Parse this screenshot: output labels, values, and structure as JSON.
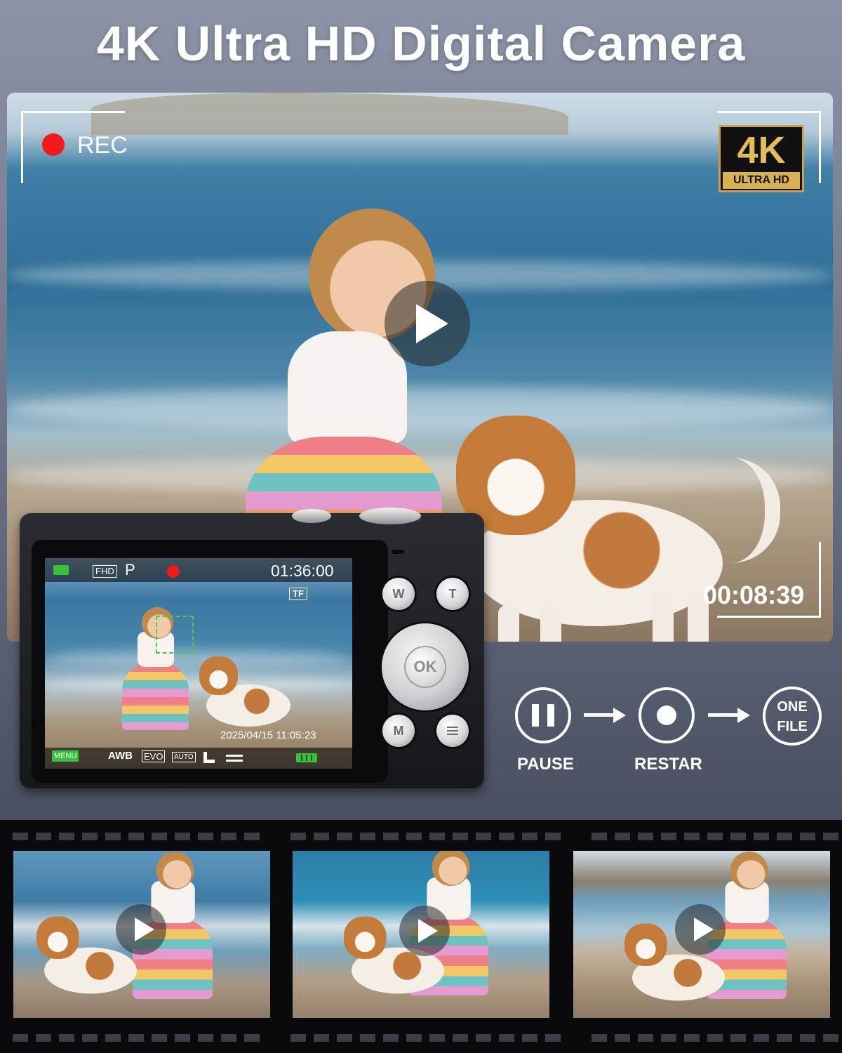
{
  "headline": "4K Ultra HD Digital Camera",
  "recording": {
    "rec_label": "REC",
    "elapsed_time": "00:08:39",
    "badge_main": "4K",
    "badge_sub": "ULTRA HD"
  },
  "camera_screen": {
    "resolution_badge": "FHD",
    "mode_letter": "P",
    "remaining_time": "01:36:00",
    "storage_badge": "TF",
    "date_time": "2025/04/15  11:05:23",
    "menu_label": "MENU",
    "white_balance": "AWB",
    "exposure": "EVO",
    "iso": "AUTO"
  },
  "camera_buttons": {
    "wide": "W",
    "tele": "T",
    "ok": "OK",
    "mode": "M"
  },
  "workflow": {
    "pause_label": "PAUSE",
    "restart_label": "RESTAR",
    "one_file_label_line1": "ONE",
    "one_file_label_line2": "FILE"
  },
  "colors": {
    "rec_red": "#ef1b1b",
    "badge_gold": "#d8b152",
    "focus_green": "#3fd046",
    "battery_green": "#34c23b"
  },
  "icons": [
    "play-icon",
    "record-dot-icon",
    "video-camera-icon",
    "battery-icon",
    "pause-icon",
    "arrow-right-icon"
  ]
}
